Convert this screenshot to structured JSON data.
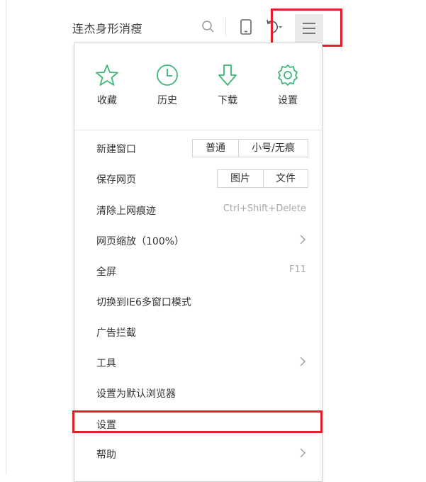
{
  "toolbar": {
    "search_text": "连杰身形消瘦",
    "icons": [
      "search-icon",
      "tablet-icon",
      "undo-icon",
      "menu-icon"
    ]
  },
  "quick_actions": [
    {
      "label": "收藏",
      "icon": "star-icon"
    },
    {
      "label": "历史",
      "icon": "clock-icon"
    },
    {
      "label": "下载",
      "icon": "download-icon"
    },
    {
      "label": "设置",
      "icon": "gear-icon"
    }
  ],
  "menu": {
    "new_window": {
      "label": "新建窗口",
      "options": [
        "普通",
        "小号/无痕"
      ]
    },
    "save_page": {
      "label": "保存网页",
      "options": [
        "图片",
        "文件"
      ]
    },
    "clear_history": {
      "label": "清除上网痕迹",
      "shortcut": "Ctrl+Shift+Delete"
    },
    "zoom": {
      "label": "网页缩放（100%）"
    },
    "fullscreen": {
      "label": "全屏",
      "shortcut": "F11"
    },
    "ie6_mode": {
      "label": "切换到IE6多窗口模式"
    },
    "adblock": {
      "label": "广告拦截"
    },
    "tools": {
      "label": "工具"
    },
    "default_browser": {
      "label": "设置为默认浏览器"
    },
    "settings": {
      "label": "设置"
    },
    "help": {
      "label": "帮助"
    }
  },
  "colors": {
    "accent_green": "#3cb878",
    "highlight_red": "#e0202c"
  }
}
